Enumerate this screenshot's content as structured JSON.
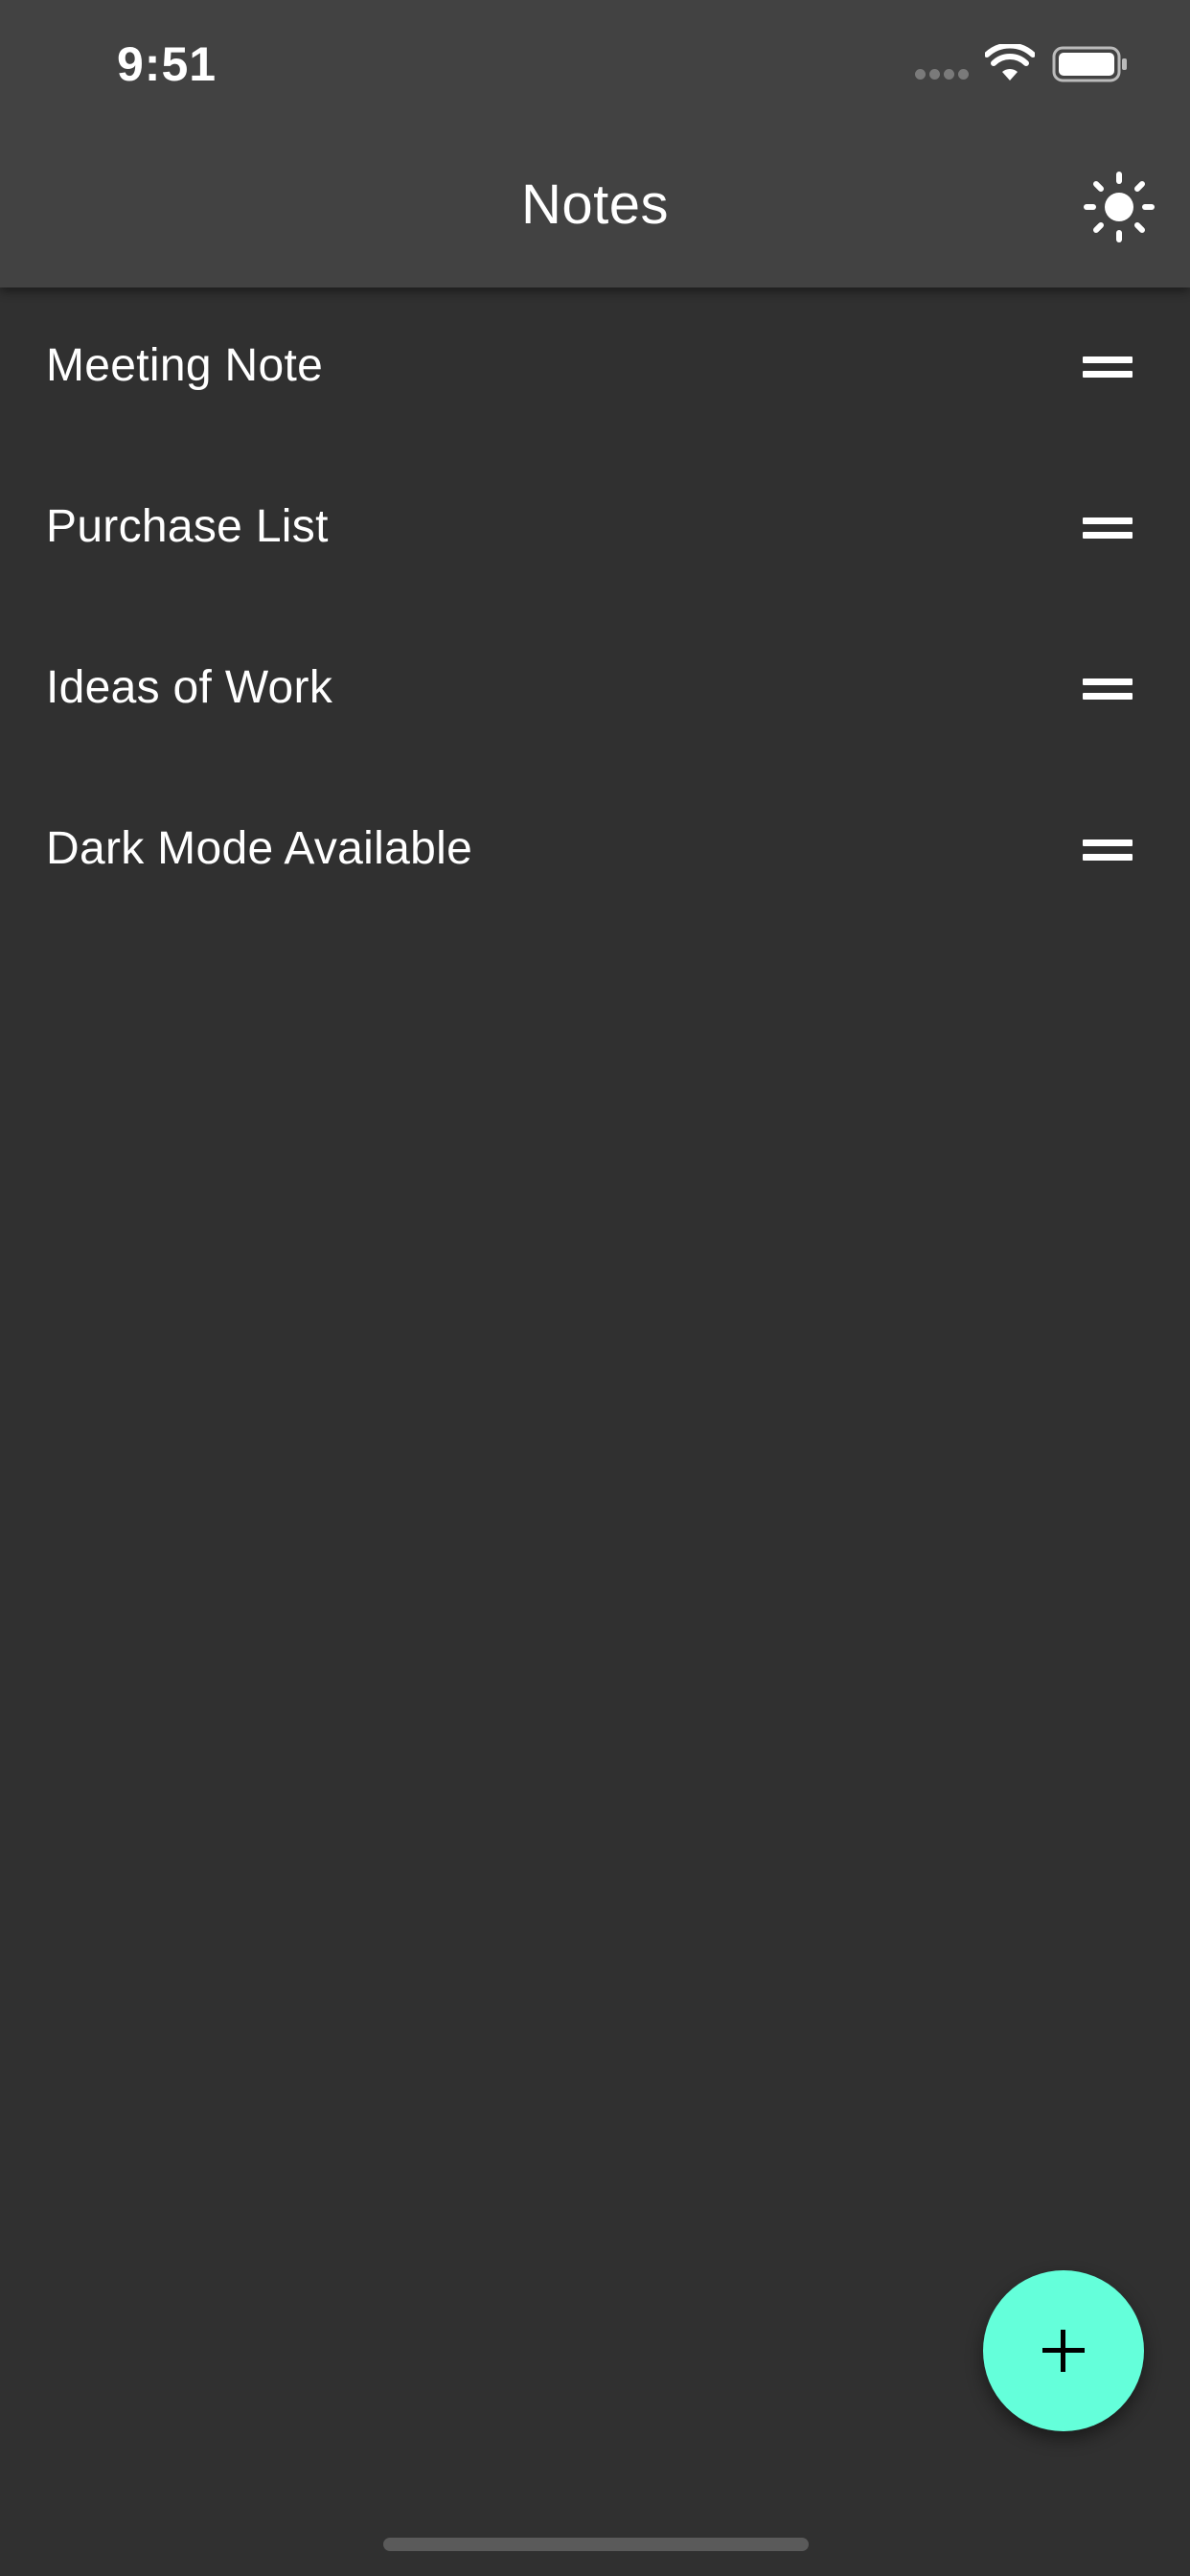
{
  "status_bar": {
    "time": "9:51",
    "signal_icon": "signal-dots-icon",
    "wifi_icon": "wifi-icon",
    "battery_icon": "battery-icon"
  },
  "app_bar": {
    "title": "Notes",
    "theme_toggle_icon": "sun-icon"
  },
  "notes": [
    {
      "title": "Meeting Note",
      "handle_icon": "drag-handle-icon"
    },
    {
      "title": "Purchase List",
      "handle_icon": "drag-handle-icon"
    },
    {
      "title": "Ideas of Work",
      "handle_icon": "drag-handle-icon"
    },
    {
      "title": "Dark Mode Available",
      "handle_icon": "drag-handle-icon"
    }
  ],
  "fab": {
    "icon": "plus-icon"
  },
  "colors": {
    "background": "#303030",
    "app_bar": "#424242",
    "accent": "#64ffda",
    "text": "#ffffff"
  }
}
